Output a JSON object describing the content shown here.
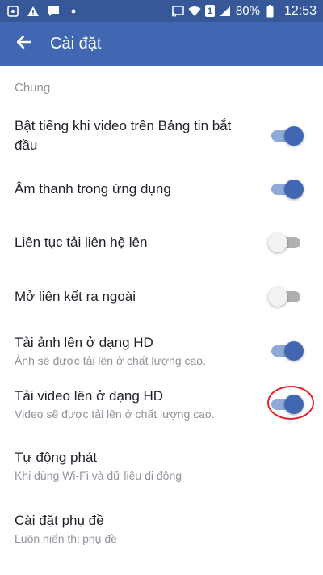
{
  "status_bar": {
    "icons_left": [
      "notification-icon",
      "warning-icon",
      "message-icon",
      "dot-icon"
    ],
    "icons_right": [
      "cast-icon",
      "wifi-icon",
      "sim-1-icon",
      "signal-icon"
    ],
    "sim_label": "1",
    "battery": "80%",
    "time": "12:53"
  },
  "app_bar": {
    "title": "Cài đặt",
    "back_icon": "arrow-left-icon"
  },
  "section": {
    "title": "Chung"
  },
  "settings": [
    {
      "title": "Bật tiếng khi video trên Bảng tin bắt đầu",
      "subtitle": "",
      "enabled": true
    },
    {
      "title": "Âm thanh trong ứng dụng",
      "subtitle": "",
      "enabled": true
    },
    {
      "title": "Liên tục tải liên hệ lên",
      "subtitle": "",
      "enabled": false
    },
    {
      "title": "Mở liên kết ra ngoài",
      "subtitle": "",
      "enabled": false
    },
    {
      "title": "Tải ảnh lên ở dạng HD",
      "subtitle": "Ảnh sẽ được tải lên ở chất lượng cao.",
      "enabled": true
    },
    {
      "title": "Tải video lên ở dạng HD",
      "subtitle": "Video sẽ được tải lên ở chất lượng cao.",
      "enabled": true
    },
    {
      "title": "Tự động phát",
      "subtitle": "Khi dùng Wi-Fi và dữ liệu di động"
    },
    {
      "title": "Cài đặt phụ đề",
      "subtitle": "Luôn hiển thị phụ đề"
    }
  ],
  "colors": {
    "status_bar": "#365899",
    "app_bar": "#4267b2",
    "toggle_on": "#4267b2",
    "annotation_ring": "#e8232b"
  }
}
